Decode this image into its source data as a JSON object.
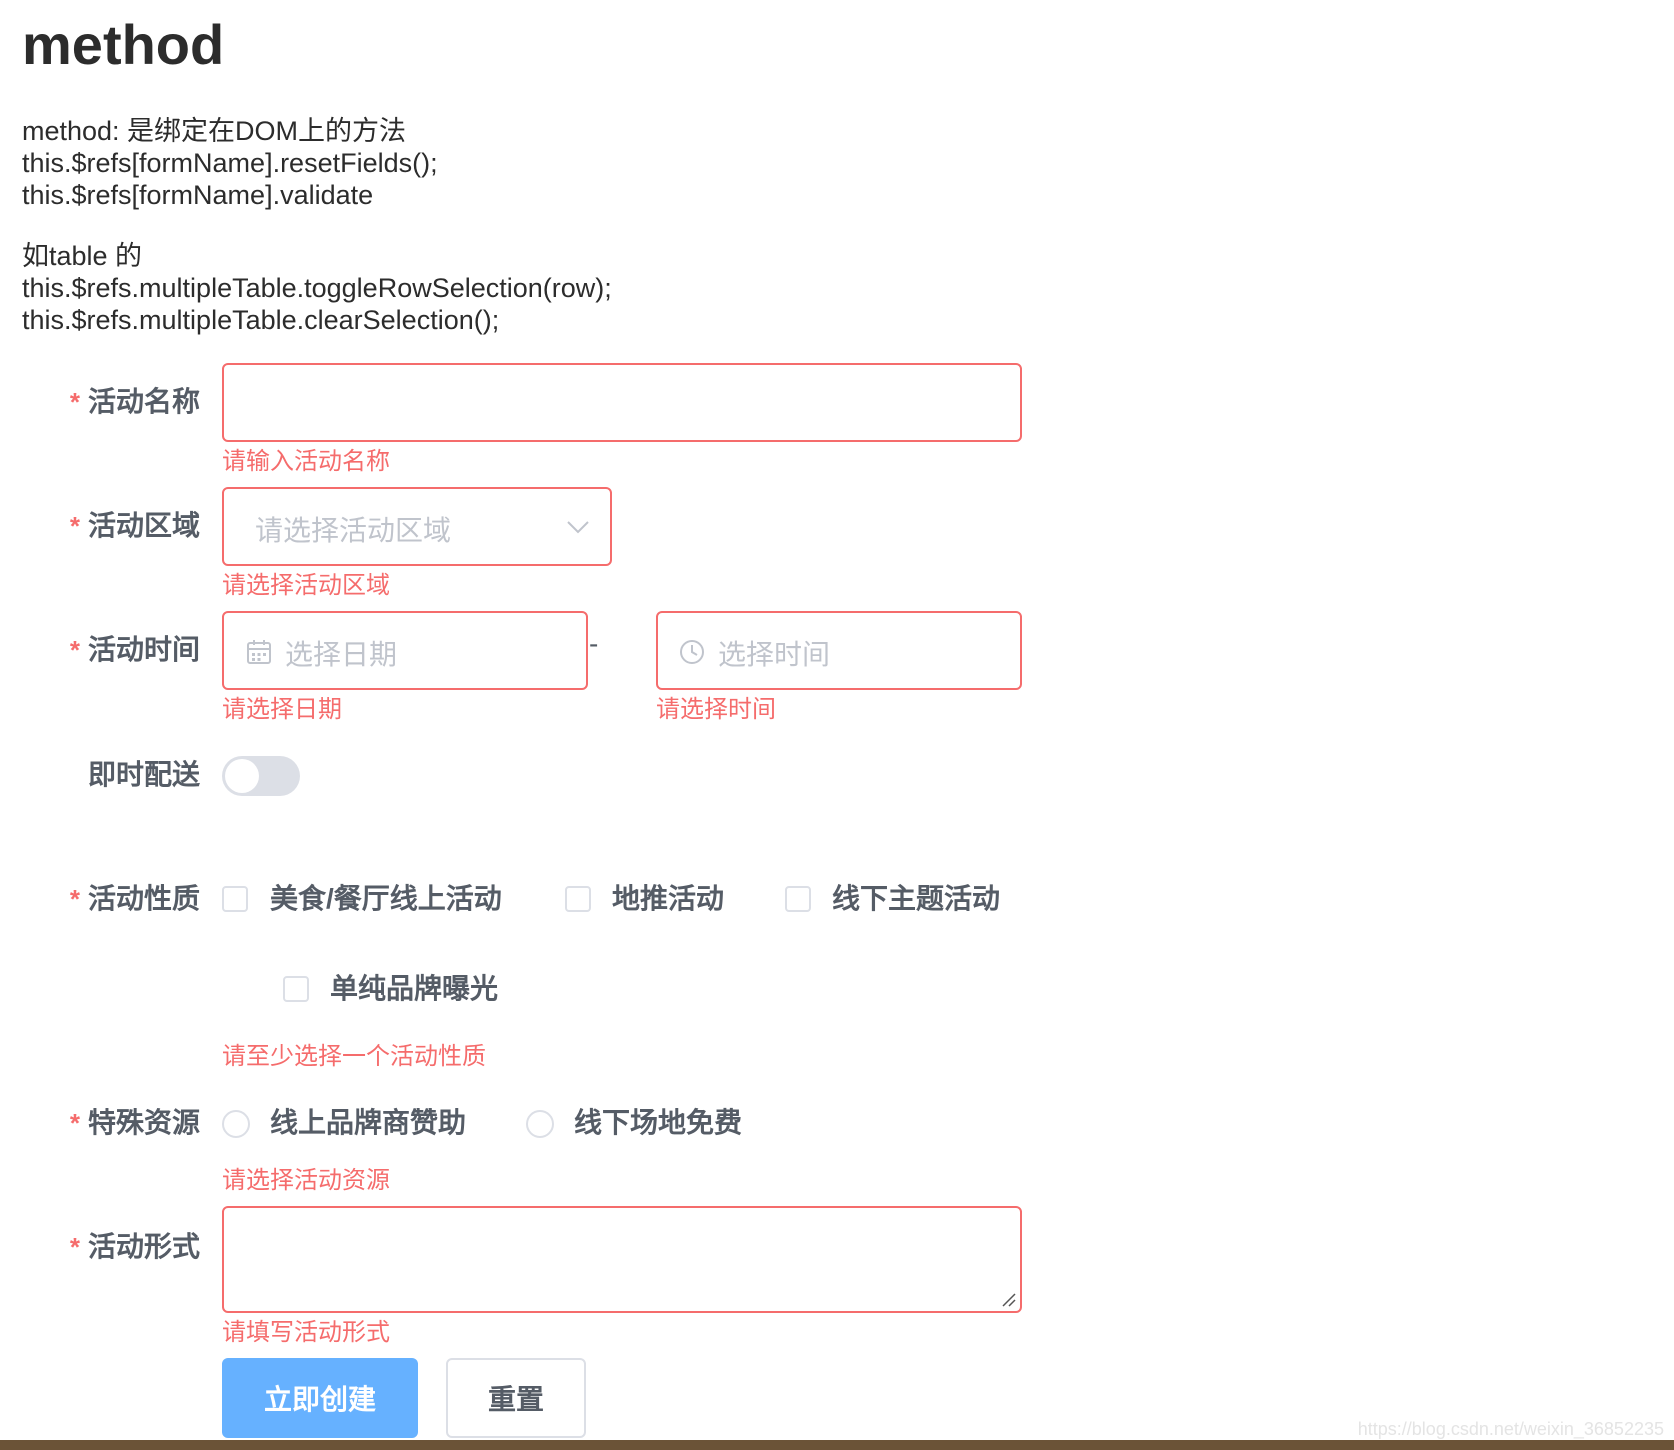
{
  "page": {
    "title": "method",
    "intro_lines": [
      "method: 是绑定在DOM上的方法",
      "this.$refs[formName].resetFields();",
      "this.$refs[formName].validate"
    ],
    "table_lines": [
      "如table 的",
      "this.$refs.multipleTable.toggleRowSelection(row);",
      "this.$refs.multipleTable.clearSelection();"
    ]
  },
  "form": {
    "required_mark": "*",
    "name": {
      "label": "活动名称",
      "value": "",
      "error": "请输入活动名称"
    },
    "region": {
      "label": "活动区域",
      "placeholder": "请选择活动区域",
      "error": "请选择活动区域"
    },
    "time": {
      "label": "活动时间",
      "date_placeholder": "选择日期",
      "separator": "-",
      "time_placeholder": "选择时间",
      "date_error": "请选择日期",
      "time_error": "请选择时间"
    },
    "delivery": {
      "label": "即时配送",
      "on": false
    },
    "type": {
      "label": "活动性质",
      "options": [
        "美食/餐厅线上活动",
        "地推活动",
        "线下主题活动",
        "单纯品牌曝光"
      ],
      "error": "请至少选择一个活动性质"
    },
    "resource": {
      "label": "特殊资源",
      "options": [
        "线上品牌商赞助",
        "线下场地免费"
      ],
      "error": "请选择活动资源"
    },
    "desc": {
      "label": "活动形式",
      "value": "",
      "error": "请填写活动形式"
    },
    "buttons": {
      "create": "立即创建",
      "reset": "重置"
    }
  },
  "colors": {
    "error": "#f56c6c",
    "primary_button": "#66b1ff",
    "label": "#555c66",
    "placeholder": "#c0c4cc"
  },
  "watermark": "https://blog.csdn.net/weixin_36852235"
}
